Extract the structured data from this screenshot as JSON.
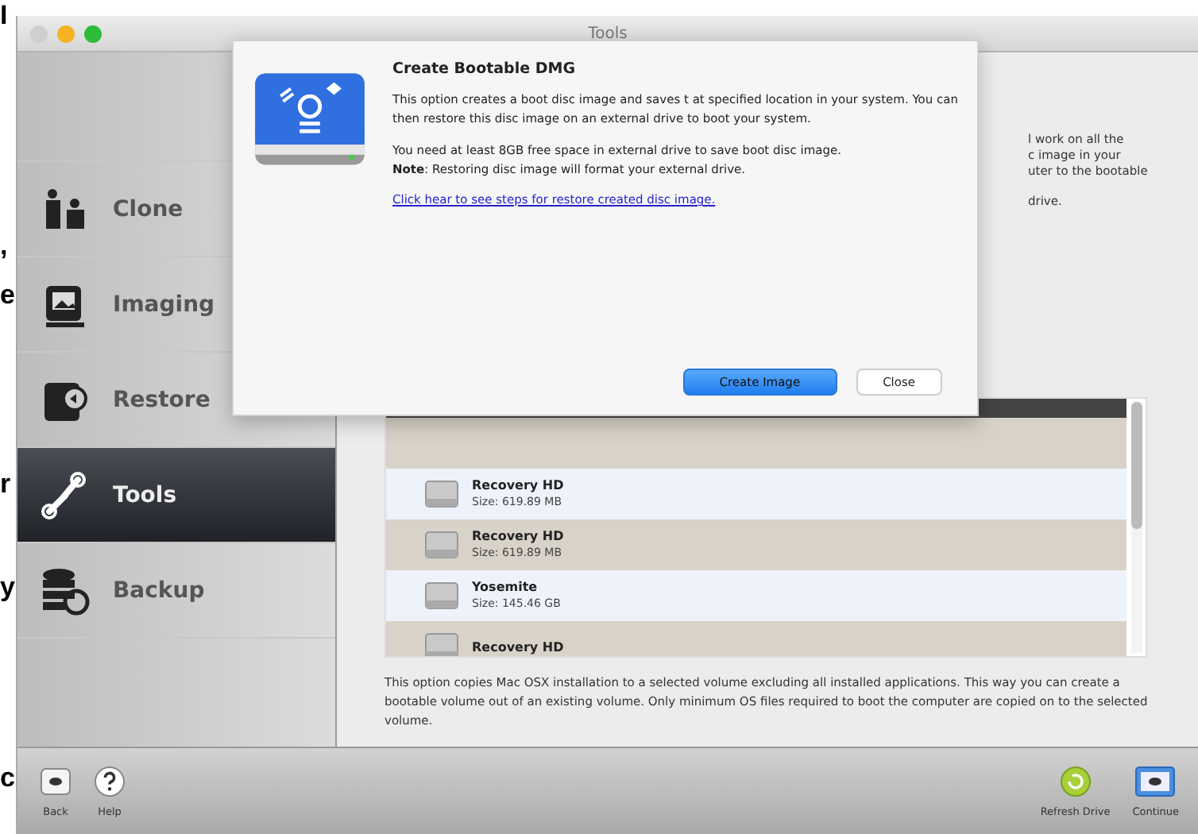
{
  "margin_fragments": [
    "I",
    ",",
    "e",
    "r",
    "y",
    "c"
  ],
  "window": {
    "title": "Tools"
  },
  "sidebar": {
    "items": [
      {
        "label": "Clone",
        "selected": false
      },
      {
        "label": "Imaging",
        "selected": false
      },
      {
        "label": "Restore",
        "selected": false
      },
      {
        "label": "Tools",
        "selected": true
      },
      {
        "label": "Backup",
        "selected": false
      }
    ]
  },
  "background_text": [
    "l work on all the",
    "c image in your",
    "uter to the bootable",
    "drive."
  ],
  "volumes": [
    {
      "name": "Recovery HD",
      "size": "Size: 619.89 MB"
    },
    {
      "name": "Recovery HD",
      "size": "Size: 619.89 MB"
    },
    {
      "name": "Yosemite",
      "size": "Size: 145.46 GB"
    },
    {
      "name": "Recovery HD"
    }
  ],
  "description": "This option copies Mac OSX installation to a selected volume excluding all installed applications. This way you can create a bootable volume out  of an existing volume. Only minimum OS files required to boot the computer are copied on to the selected volume.",
  "dialog": {
    "title": "Create Bootable DMG",
    "body": "This option creates a boot disc image and saves t at specified location in your system. You can then restore this disc image on an external drive to boot your system.",
    "requirement": "You need at least 8GB free space in external drive to save boot disc image.",
    "note": "**Note**: Restoring disc image will format your external drive.",
    "link": "Click hear to see steps for restore created disc image.",
    "primary_button": "Create Image",
    "secondary_button": "Close"
  },
  "toolbar": {
    "left": [
      {
        "label": "Back"
      },
      {
        "label": "Help"
      }
    ],
    "right": [
      {
        "label": "Refresh Drive"
      },
      {
        "label": "Continue"
      }
    ]
  }
}
